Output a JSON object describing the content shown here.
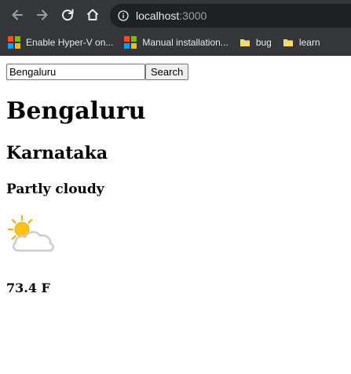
{
  "browser": {
    "address": {
      "host": "localhost",
      "port": ":3000"
    },
    "bookmarks": [
      {
        "label": "Enable Hyper-V on...",
        "icon": "microsoft-logo-icon"
      },
      {
        "label": "Manual installation...",
        "icon": "microsoft-logo-icon"
      },
      {
        "label": "bug",
        "icon": "folder-icon"
      },
      {
        "label": "learn",
        "icon": "folder-icon"
      }
    ],
    "colors": {
      "chrome": "#35363a",
      "omnibox": "#202124",
      "folder": "#f8d775"
    }
  },
  "search": {
    "value": "Bengaluru",
    "button_label": "Search"
  },
  "weather": {
    "city": "Bengaluru",
    "region": "Karnataka",
    "condition": "Partly cloudy",
    "icon": "partly-cloudy-icon",
    "temperature": "73.4 F"
  }
}
